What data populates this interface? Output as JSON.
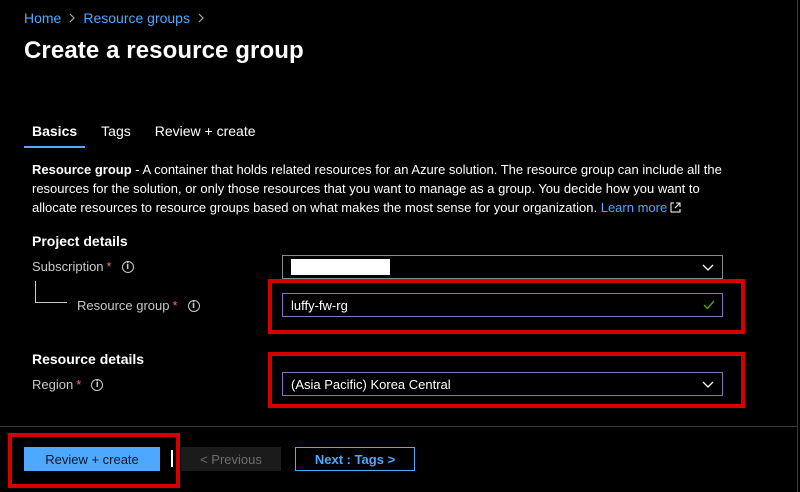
{
  "breadcrumb": {
    "home": "Home",
    "resource_groups": "Resource groups"
  },
  "page": {
    "title": "Create a resource group"
  },
  "tabs": [
    {
      "label": "Basics",
      "active": true
    },
    {
      "label": "Tags",
      "active": false
    },
    {
      "label": "Review + create",
      "active": false
    }
  ],
  "description": {
    "lead": "Resource group",
    "text": " - A container that holds related resources for an Azure solution. The resource group can include all the resources for the solution, or only those resources that you want to manage as a group. You decide how you want to allocate resources to resource groups based on what makes the most sense for your organization.",
    "link": "Learn more"
  },
  "project_details": {
    "title": "Project details",
    "subscription_label": "Subscription",
    "subscription_value": "",
    "resource_group_label": "Resource group",
    "resource_group_value": "luffy-fw-rg"
  },
  "resource_details": {
    "title": "Resource details",
    "region_label": "Region",
    "region_value": "(Asia Pacific) Korea Central"
  },
  "required_mark": "*",
  "footer": {
    "review_create": "Review + create",
    "previous": "< Previous",
    "next": "Next : Tags >"
  },
  "colors": {
    "accent": "#4fa8ff",
    "highlight": "#d30000",
    "valid": "#8d6bbf"
  }
}
